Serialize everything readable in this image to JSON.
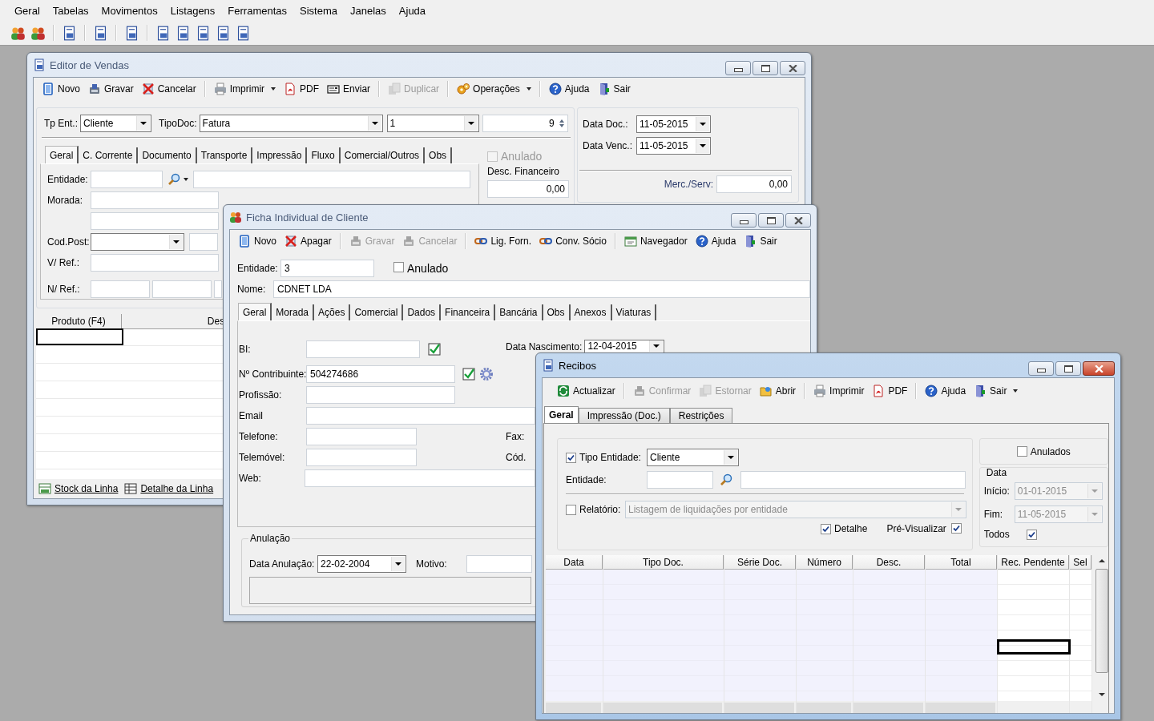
{
  "menu": [
    "Geral",
    "Tabelas",
    "Movimentos",
    "Listagens",
    "Ferramentas",
    "Sistema",
    "Janelas",
    "Ajuda"
  ],
  "editor_vendas": {
    "title": "Editor de Vendas",
    "toolbar": [
      [
        {
          "label": "Novo",
          "disabled": false
        },
        {
          "label": "Gravar",
          "disabled": false
        },
        {
          "label": "Cancelar",
          "disabled": false
        }
      ],
      [
        {
          "label": "Imprimir",
          "disabled": false,
          "dropdown": true
        },
        {
          "label": "PDF",
          "disabled": false
        },
        {
          "label": "Enviar",
          "disabled": false
        }
      ],
      [
        {
          "label": "Duplicar",
          "disabled": true
        }
      ],
      [
        {
          "label": "Operações",
          "disabled": false,
          "dropdown": true
        }
      ],
      [
        {
          "label": "Ajuda",
          "disabled": false
        },
        {
          "label": "Sair",
          "disabled": false
        }
      ]
    ],
    "tp_ent": {
      "label": "Tp Ent.:",
      "value": "Cliente"
    },
    "tipo_doc": {
      "label": "TipoDoc:",
      "value": "Fatura"
    },
    "serie": {
      "value": "1"
    },
    "numero": {
      "value": "9"
    },
    "data_doc": {
      "label": "Data Doc.:",
      "value": "11-05-2015"
    },
    "data_venc": {
      "label": "Data Venc.:",
      "value": "11-05-2015"
    },
    "tabs": [
      {
        "label": "Geral",
        "selected": true
      },
      {
        "label": "C. Corrente",
        "selected": false
      },
      {
        "label": "Documento",
        "selected": false
      },
      {
        "label": "Transporte",
        "selected": false
      },
      {
        "label": "Impressão",
        "selected": false
      },
      {
        "label": "Fluxo",
        "selected": false
      },
      {
        "label": "Comercial/Outros",
        "selected": false
      },
      {
        "label": "Obs",
        "selected": false
      }
    ],
    "anulado": {
      "label": "Anulado",
      "checked": false,
      "disabled": true
    },
    "desc_financeiro": {
      "label": "Desc. Financeiro",
      "value": "0,00"
    },
    "merc_serv": {
      "label": "Merc./Serv:",
      "value": "0,00"
    },
    "labels": {
      "entidade": "Entidade:",
      "morada": "Morada:",
      "cod_post": "Cod.Post:",
      "v_ref": "V/ Ref.:",
      "n_ref": "N/ Ref.:"
    },
    "grid": {
      "columns": [
        "Produto (F4)",
        "Des"
      ]
    },
    "footer_buttons": [
      "Stock da Linha",
      "Detalhe da Linha"
    ]
  },
  "ficha_cliente": {
    "title": "Ficha Individual de Cliente",
    "toolbar": [
      [
        {
          "label": "Novo",
          "disabled": false
        },
        {
          "label": "Apagar",
          "disabled": false
        }
      ],
      [
        {
          "label": "Gravar",
          "disabled": true
        },
        {
          "label": "Cancelar",
          "disabled": true
        }
      ],
      [
        {
          "label": "Lig. Forn.",
          "disabled": false
        },
        {
          "label": "Conv. Sócio",
          "disabled": false
        }
      ],
      [
        {
          "label": "Navegador",
          "disabled": false
        },
        {
          "label": "Ajuda",
          "disabled": false
        },
        {
          "label": "Sair",
          "disabled": false
        }
      ]
    ],
    "entidade": {
      "label": "Entidade:",
      "value": "3"
    },
    "anulado": {
      "label": "Anulado",
      "checked": false
    },
    "nome": {
      "label": "Nome:",
      "value": "CDNET LDA"
    },
    "tabs": [
      {
        "label": "Geral",
        "selected": true
      },
      {
        "label": "Morada",
        "selected": false
      },
      {
        "label": "Ações",
        "selected": false
      },
      {
        "label": "Comercial",
        "selected": false
      },
      {
        "label": "Dados",
        "selected": false
      },
      {
        "label": "Financeira",
        "selected": false
      },
      {
        "label": "Bancária",
        "selected": false
      },
      {
        "label": "Obs",
        "selected": false
      },
      {
        "label": "Anexos",
        "selected": false
      },
      {
        "label": "Viaturas",
        "selected": false
      }
    ],
    "bi": {
      "label": "BI:"
    },
    "contribuinte": {
      "label": "Nº Contribuinte:",
      "value": "504274686"
    },
    "profissao": {
      "label": "Profissão:"
    },
    "email": {
      "label": "Email"
    },
    "telefone": {
      "label": "Telefone:"
    },
    "telemovel": {
      "label": "Telemóvel:"
    },
    "web": {
      "label": "Web:"
    },
    "data_nascimento": {
      "label": "Data Nascimento:",
      "value": "12-04-2015"
    },
    "fax": {
      "label": "Fax:"
    },
    "cod": {
      "label": "Cód."
    },
    "anulacao": {
      "title": "Anulação",
      "data_label": "Data Anulação:",
      "data_value": "22-02-2004",
      "motivo_label": "Motivo:"
    }
  },
  "recibos": {
    "title": "Recibos",
    "toolbar": [
      [
        {
          "label": "Actualizar",
          "disabled": false
        }
      ],
      [
        {
          "label": "Confirmar",
          "disabled": true
        },
        {
          "label": "Estornar",
          "disabled": true
        },
        {
          "label": "Abrir",
          "disabled": false
        }
      ],
      [
        {
          "label": "Imprimir",
          "disabled": false
        },
        {
          "label": "PDF",
          "disabled": false
        }
      ],
      [
        {
          "label": "Ajuda",
          "disabled": false
        },
        {
          "label": "Sair",
          "disabled": false,
          "dropdown": true
        }
      ]
    ],
    "tabs": [
      {
        "label": "Geral",
        "selected": true
      },
      {
        "label": "Impressão (Doc.)",
        "selected": false
      },
      {
        "label": "Restrições",
        "selected": false
      }
    ],
    "tipo_entidade": {
      "label": "Tipo Entidade:",
      "checked": true,
      "value": "Cliente"
    },
    "entidade": {
      "label": "Entidade:"
    },
    "relatorio": {
      "label": "Relatório:",
      "checked": false,
      "value": "Listagem de liquidações por entidade",
      "disabled": true
    },
    "detalhe": {
      "label": "Detalhe",
      "checked": true
    },
    "pre_visualizar": {
      "label": "Pré-Visualizar",
      "checked": true
    },
    "anulados": {
      "label": "Anulados",
      "checked": false
    },
    "data": {
      "title": "Data",
      "inicio": {
        "label": "Início:",
        "value": "01-01-2015",
        "disabled": true
      },
      "fim": {
        "label": "Fim:",
        "value": "11-05-2015",
        "disabled": true
      },
      "todos": {
        "label": "Todos",
        "checked": true
      }
    },
    "grid": {
      "columns": [
        "Data",
        "Tipo Doc.",
        "Série Doc.",
        "Número",
        "Desc.",
        "Total",
        "Rec. Pendente",
        "Sel"
      ]
    }
  }
}
